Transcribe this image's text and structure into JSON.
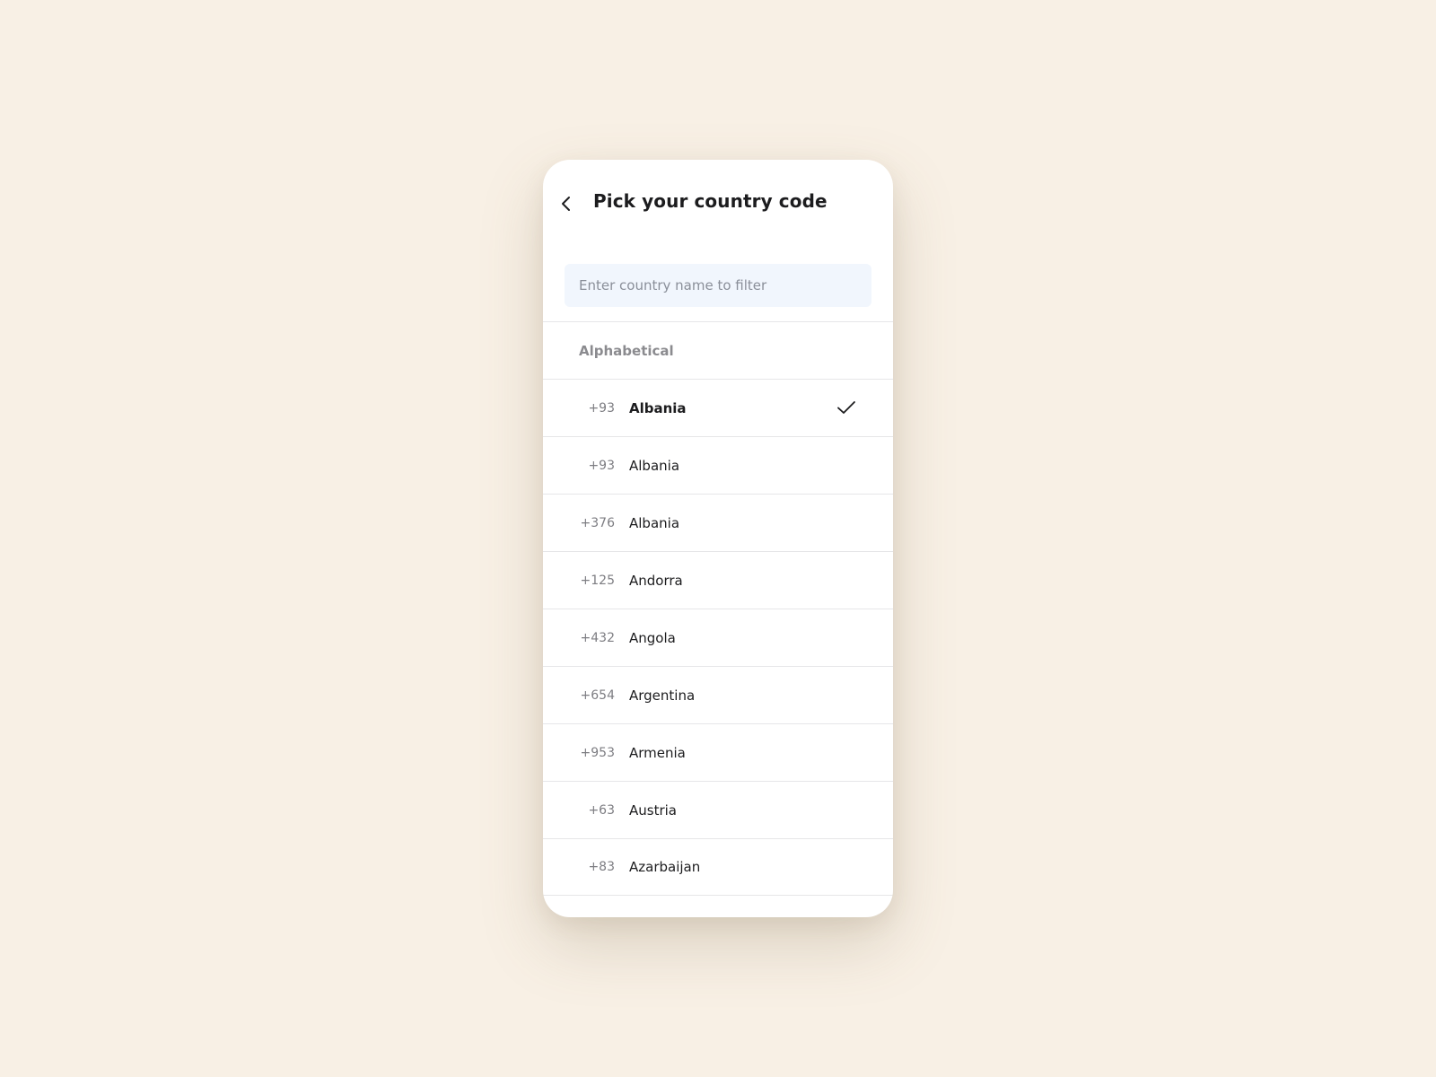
{
  "header": {
    "title": "Pick your country code",
    "back_icon": "chevron-left-icon"
  },
  "search": {
    "placeholder": "Enter country name to filter",
    "value": ""
  },
  "list": {
    "section_label": "Alphabetical",
    "selected_icon": "checkmark-icon",
    "items": [
      {
        "code": "+93",
        "name": "Albania",
        "selected": true
      },
      {
        "code": "+93",
        "name": "Albania",
        "selected": false
      },
      {
        "code": "+376",
        "name": "Albania",
        "selected": false
      },
      {
        "code": "+125",
        "name": "Andorra",
        "selected": false
      },
      {
        "code": "+432",
        "name": "Angola",
        "selected": false
      },
      {
        "code": "+654",
        "name": "Argentina",
        "selected": false
      },
      {
        "code": "+953",
        "name": "Armenia",
        "selected": false
      },
      {
        "code": "+63",
        "name": "Austria",
        "selected": false
      },
      {
        "code": "+83",
        "name": "Azarbaijan",
        "selected": false
      }
    ]
  },
  "colors": {
    "background": "#f8f0e5",
    "card": "#ffffff",
    "search_bg": "#f1f6fd",
    "text_primary": "#1c1c1e",
    "text_secondary": "#7d7d82",
    "divider": "#e6e6e8"
  }
}
